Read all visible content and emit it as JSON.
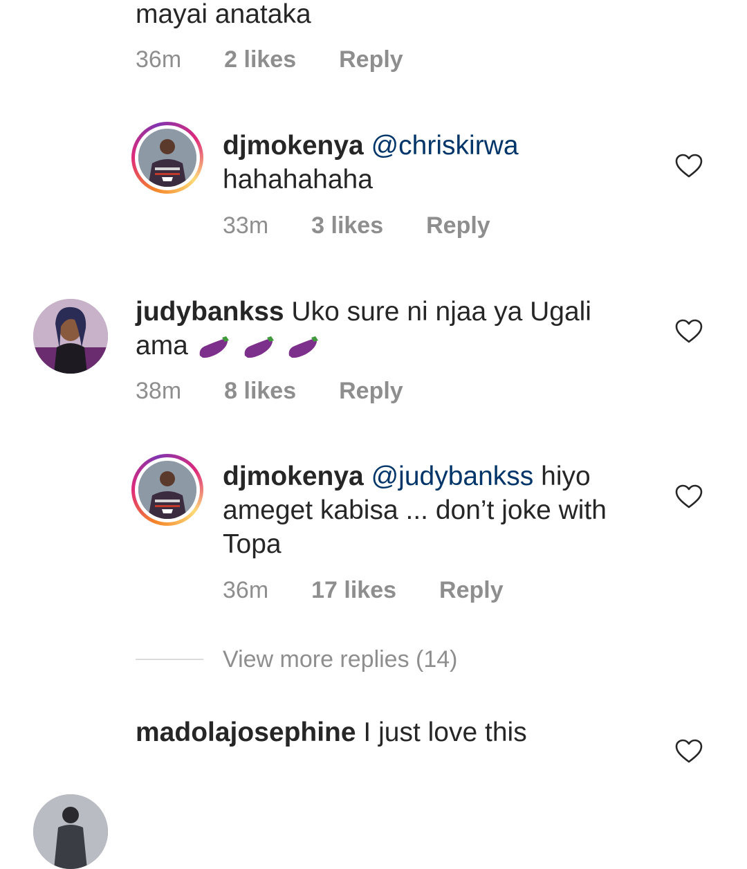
{
  "comments": [
    {
      "id": "c0",
      "text_tail": "mayai anataka",
      "time": "36m",
      "likes": "2 likes",
      "reply": "Reply"
    },
    {
      "id": "r1",
      "username": "djmokenya",
      "mention": "@chriskirwa",
      "text_line2": "hahahahaha",
      "time": "33m",
      "likes": "3 likes",
      "reply": "Reply"
    },
    {
      "id": "c1",
      "username": "judybankss",
      "text_line1": "Uko sure ni njaa ya Ugali",
      "text_line2": "ama",
      "emoji": "eggplant-icon",
      "time": "38m",
      "likes": "8 likes",
      "reply": "Reply"
    },
    {
      "id": "r2",
      "username": "djmokenya",
      "mention": "@judybankss",
      "text_line1_rest": "hiyo",
      "text_line2": "ameget kabisa ... don’t joke with",
      "text_line3": "Topa",
      "time": "36m",
      "likes": "17 likes",
      "reply": "Reply"
    },
    {
      "id": "c2",
      "username": "madolajosephine",
      "text_line1": "I just love this"
    }
  ],
  "view_more": "View more replies (14)",
  "colors": {
    "text": "#262626",
    "meta": "#8e8e8e",
    "mention": "#003569",
    "divider": "#dbdbdb"
  }
}
